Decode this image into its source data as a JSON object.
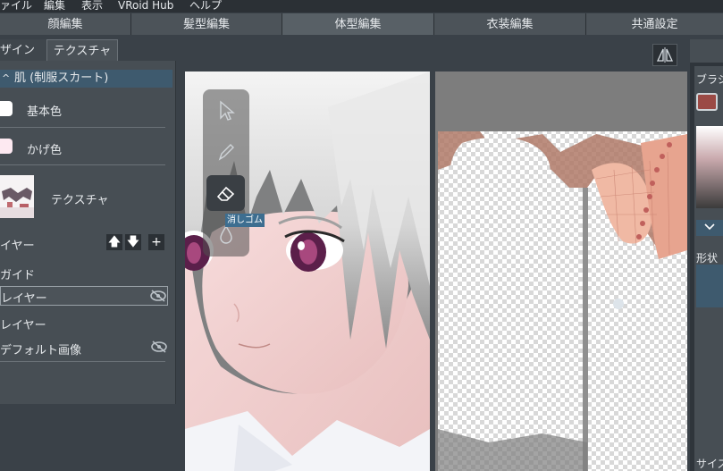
{
  "menu": [
    "ァイル",
    "編集",
    "表示",
    "VRoid Hub",
    "ヘルプ"
  ],
  "modes": [
    "顔編集",
    "髪型編集",
    "体型編集",
    "衣装編集",
    "共通設定"
  ],
  "left_tabs": [
    "ザイン",
    "テクスチャ"
  ],
  "section": {
    "title": "肌 (制服スカート)",
    "collapse_glyph": "^"
  },
  "colors": {
    "base_label": "基本色",
    "shade_label": "かげ色",
    "base_swatch": "#ffffff",
    "shade_swatch": "#fde9f1",
    "accent": "#3e5a6e"
  },
  "texture_label": "テクスチャ",
  "layer_header": "イヤー",
  "layer_buttons": {
    "up": "🡅",
    "down": "🡇",
    "add": "+"
  },
  "layers": [
    "ガイド",
    "レイヤー",
    "レイヤー",
    "デフォルト画像"
  ],
  "tool": {
    "tooltip": "消しゴム"
  },
  "right": {
    "brush_label": "ブラシ",
    "shape_label": "形状",
    "size_label": "サイズ",
    "brush_color": "#9b4a45"
  }
}
